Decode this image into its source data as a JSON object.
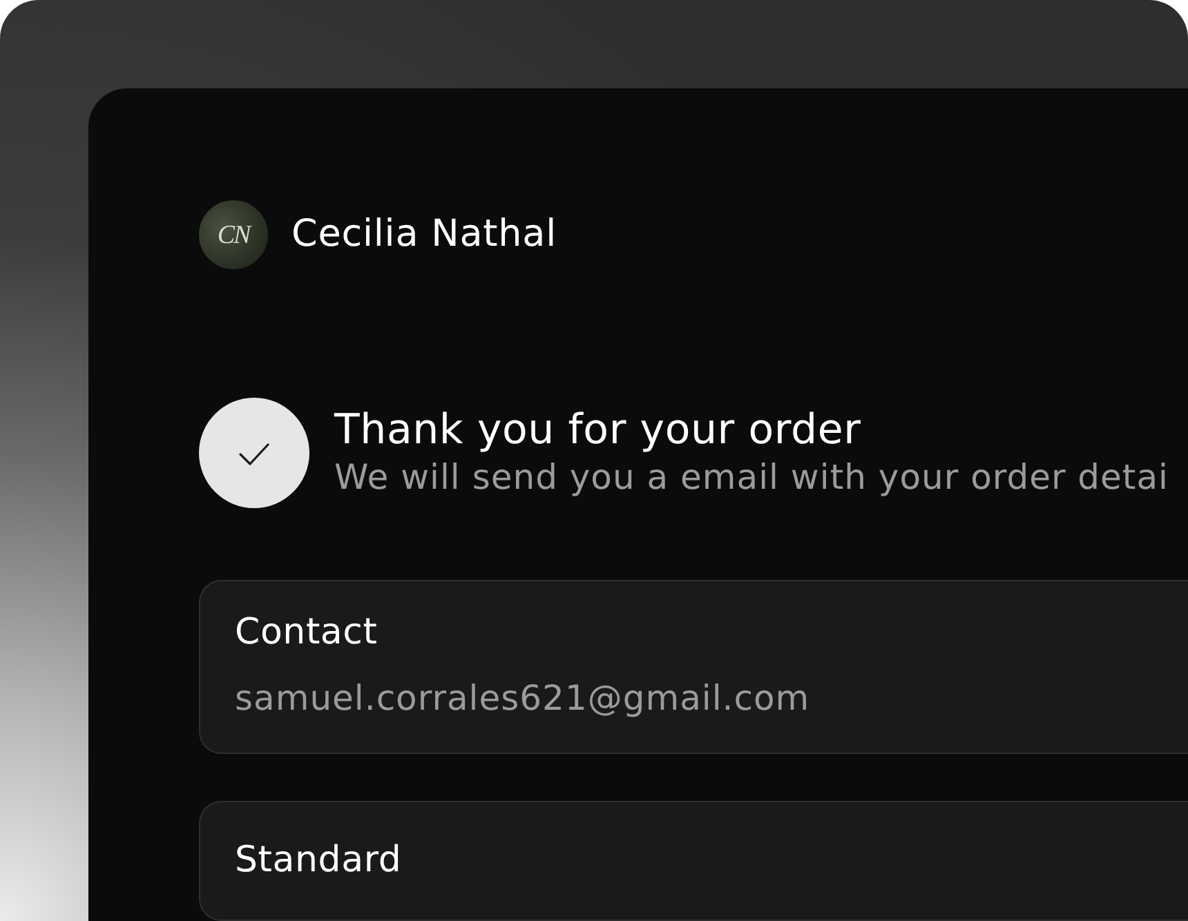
{
  "user": {
    "initials": "CN",
    "name": "Cecilia Nathal"
  },
  "confirmation": {
    "title": "Thank you for your order",
    "message": "We will send you a email with your order detai"
  },
  "sections": [
    {
      "title": "Contact",
      "value": "samuel.corrales621@gmail.com"
    },
    {
      "title": "Standard"
    }
  ]
}
